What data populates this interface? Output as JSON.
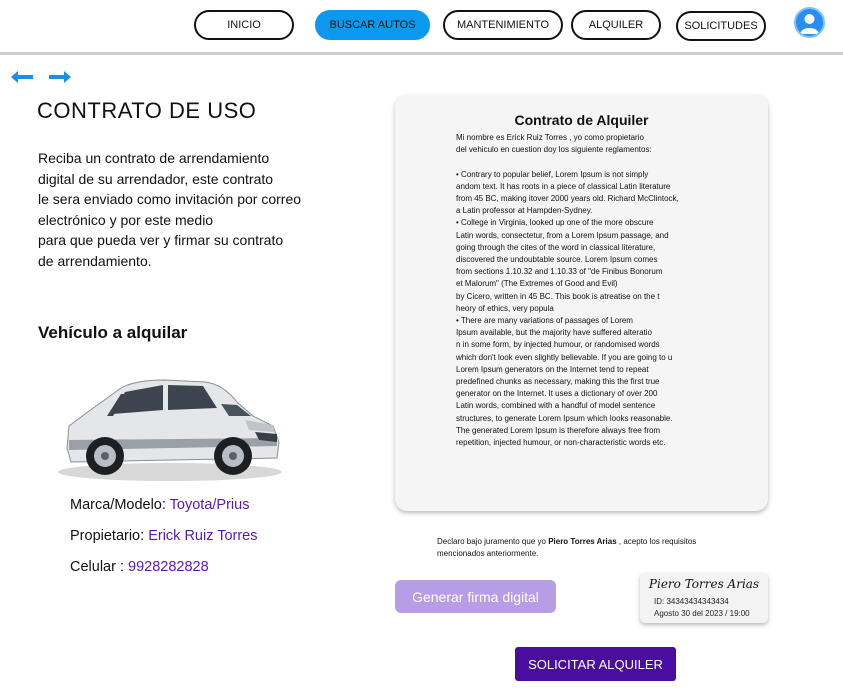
{
  "nav": {
    "items": [
      "INICIO",
      "BUSCAR AUTOS",
      "MANTENIMIENTO",
      "ALQUILER",
      "SOLICITUDES"
    ]
  },
  "page": {
    "title": "CONTRATO DE USO",
    "description_lines": [
      "Reciba un contrato de arrendamiento",
      "digital de su arrendador, este contrato",
      "le sera enviado como invitación por correo",
      "electrónico y por este medio",
      "para que pueda ver y firmar su contrato",
      "de arrendamiento."
    ],
    "vehicle_heading": "Vehículo a alquilar"
  },
  "vehicle": {
    "model_label": "Marca/Modelo: ",
    "model_value": "Toyota/Prius",
    "owner_label": "Propietario: ",
    "owner_value": "Erick Ruiz Torres",
    "phone_label": "Celular : ",
    "phone_value": "9928282828"
  },
  "contract": {
    "title": "Contrato de Alquiler",
    "lines": [
      "Mi nombre es Erick Ruiz Torres , yo como propietario",
      "del vehiculo en cuestion doy los siguiente  reglamentos:",
      "",
      "  •  Contrary to popular belief, Lorem Ipsum is not simply",
      "andom text. It has roots in a piece of classical Latin literature",
      " from 45 BC, making itover 2000 years old. Richard McClintock,",
      "a Latin professor at Hampden-Sydney.",
      "  •  College in Virginia, looked up one of the more obscure",
      " Latin words, consectetur, from a Lorem Ipsum passage, and",
      "going through the cites of the word in classical literature,",
      "discovered the undoubtable source. Lorem Ipsum comes",
      " from sections 1.10.32 and 1.10.33 of \"de Finibus Bonorum",
      " et Malorum\" (The Extremes of Good and Evil)",
      " by Cicero, written in 45 BC. This book is atreatise on the t",
      "heory of ethics, very popula",
      "  •  There are many variations of passages of Lorem",
      " Ipsum available, but the majority have suffered alteratio",
      "n in some form, by injected humour, or randomised words",
      "which don't look even slightly believable. If you are going to u",
      "Lorem Ipsum generators on the Internet tend to repeat",
      "predefined chunks as necessary, making this the first true",
      " generator on the Internet. It uses a dictionary of over 200",
      "Latin words, combined with a handful of model sentence",
      "structures, to generate Lorem Ipsum which looks reasonable.",
      " The generated Lorem Ipsum is therefore always free from",
      " repetition, injected humour, or non-characteristic words etc."
    ]
  },
  "declaration": {
    "before": "Declaro bajo juramento que yo ",
    "name": "Piero Torres Arias",
    "after": " , acepto los requisitos mencionados anteriormente."
  },
  "signature": {
    "button_label": "Generar firma digital",
    "name": "Piero Torres Arias",
    "id": "ID: 34343434343434",
    "date": "Agosto 30 del 2023 / 19:00"
  },
  "submit_label": "SOLICITAR ALQUILER",
  "colors": {
    "primary": "#0a99ee",
    "accent": "#4a0e9e",
    "link": "#5a1aa8",
    "signature_button": "#b79ce6"
  },
  "icons": {
    "back": "arrow-left-icon",
    "forward": "arrow-right-icon",
    "user": "user-avatar-icon"
  }
}
